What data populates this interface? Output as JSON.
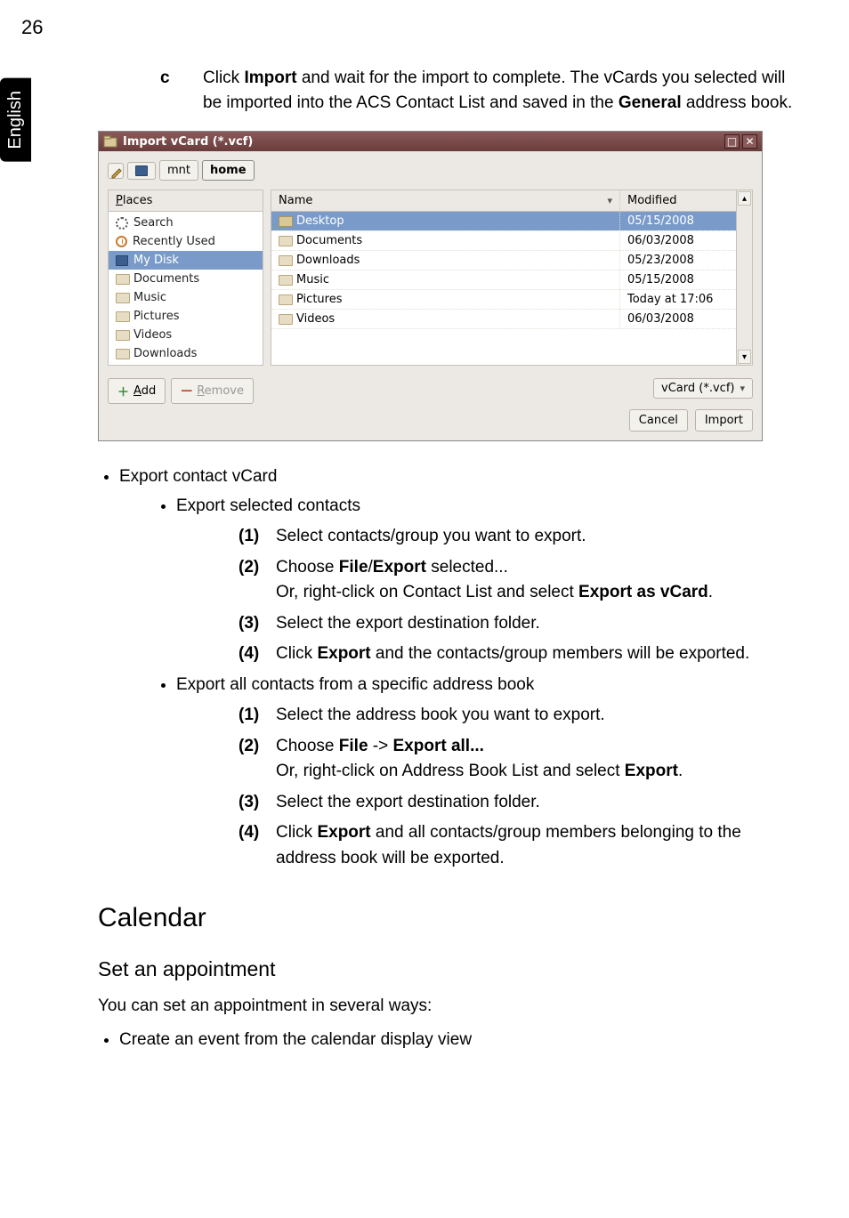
{
  "page": {
    "number": "26",
    "language_tab": "English"
  },
  "step_c": {
    "letter": "c",
    "text_pre": "Click ",
    "import_word": "Import",
    "text_mid": " and wait for the import to complete. The vCards you selected will be imported into the ACS Contact List and saved in the ",
    "general_word": "General",
    "text_post": " address book."
  },
  "dialog": {
    "title": "Import vCard (*.vcf)",
    "breadcrumb": {
      "root_icon": "disk",
      "seg1": "mnt",
      "seg2": "home"
    },
    "places_header": "Places",
    "files_headers": {
      "name": "Name",
      "modified": "Modified"
    },
    "places": [
      {
        "icon": "gear",
        "label": "Search",
        "selected": false
      },
      {
        "icon": "recent",
        "label": "Recently Used",
        "selected": false
      },
      {
        "icon": "disk",
        "label": "My Disk",
        "selected": true
      },
      {
        "icon": "folder",
        "label": "Documents",
        "selected": false
      },
      {
        "icon": "folder",
        "label": "Music",
        "selected": false
      },
      {
        "icon": "folder",
        "label": "Pictures",
        "selected": false
      },
      {
        "icon": "folder",
        "label": "Videos",
        "selected": false
      },
      {
        "icon": "folder",
        "label": "Downloads",
        "selected": false
      }
    ],
    "files": [
      {
        "icon": "open-folder",
        "name": "Desktop",
        "modified": "05/15/2008",
        "selected": true
      },
      {
        "icon": "folder",
        "name": "Documents",
        "modified": "06/03/2008",
        "selected": false
      },
      {
        "icon": "folder",
        "name": "Downloads",
        "modified": "05/23/2008",
        "selected": false
      },
      {
        "icon": "folder",
        "name": "Music",
        "modified": "05/15/2008",
        "selected": false
      },
      {
        "icon": "folder",
        "name": "Pictures",
        "modified": "Today at 17:06",
        "selected": false
      },
      {
        "icon": "folder",
        "name": "Videos",
        "modified": "06/03/2008",
        "selected": false
      }
    ],
    "buttons": {
      "add": "Add",
      "remove": "Remove",
      "filter": "vCard (*.vcf)",
      "cancel": "Cancel",
      "import": "Import"
    }
  },
  "below": {
    "b1": "Export contact vCard",
    "b1a": "Export selected contacts",
    "b1a_steps": {
      "s1": {
        "n": "(1)",
        "t": "Select contacts/group you want to export."
      },
      "s2": {
        "n": "(2)",
        "pre": "Choose ",
        "file": "File",
        "sep": "/",
        "export": "Export",
        "mid": " selected...",
        "line2_pre": "Or, right-click on Contact List and select ",
        "exportas": "Export as vCard",
        "post": "."
      },
      "s3": {
        "n": "(3)",
        "t": "Select the export destination folder."
      },
      "s4": {
        "n": "(4)",
        "pre": "Click ",
        "export": "Export",
        "post": " and the contacts/group members will be exported."
      }
    },
    "b1b": "Export all contacts from a specific address book",
    "b1b_steps": {
      "s1": {
        "n": "(1)",
        "t": "Select the address book you want to export."
      },
      "s2": {
        "n": "(2)",
        "pre": "Choose ",
        "file": "File",
        "arrow": " -> ",
        "exportall": "Export all...",
        "line2_pre": "Or, right-click on Address Book List and select ",
        "export": "Export",
        "post": "."
      },
      "s3": {
        "n": "(3)",
        "t": "Select the export destination folder."
      },
      "s4": {
        "n": "(4)",
        "pre": "Click ",
        "export": "Export",
        "post": " and all contacts/group members belonging to the address book will be exported."
      }
    },
    "h_calendar": "Calendar",
    "h_set": "Set an appointment",
    "p_set": "You can set an appointment in several ways:",
    "b_last": "Create an event from the calendar display view"
  }
}
